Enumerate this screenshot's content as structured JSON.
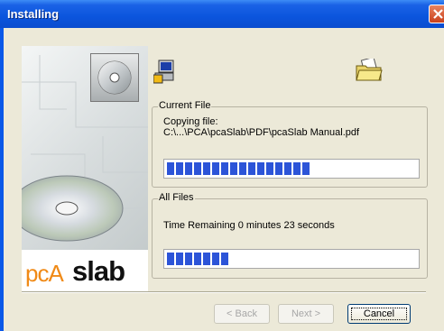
{
  "window": {
    "title": "Installing"
  },
  "side_panel": {
    "logo_prefix": "pcA",
    "logo_main": "slab"
  },
  "current_file": {
    "legend": "Current File",
    "action": "Copying file:",
    "path": "C:\\...\\PCA\\pcaSlab\\PDF\\pcaSlab Manual.pdf",
    "progress": 0.6
  },
  "all_files": {
    "legend": "All Files",
    "time_remaining": "Time Remaining 0 minutes 23 seconds",
    "progress": 0.26
  },
  "buttons": {
    "back": "< Back",
    "next": "Next >",
    "cancel": "Cancel"
  },
  "colors": {
    "title_bar": "#0a58e8",
    "progress_block": "#2c54d8",
    "dialog_bg": "#ece9d8"
  },
  "icons": [
    "computer-disk-icon",
    "open-folder-icon",
    "close-icon",
    "cd-icon"
  ]
}
